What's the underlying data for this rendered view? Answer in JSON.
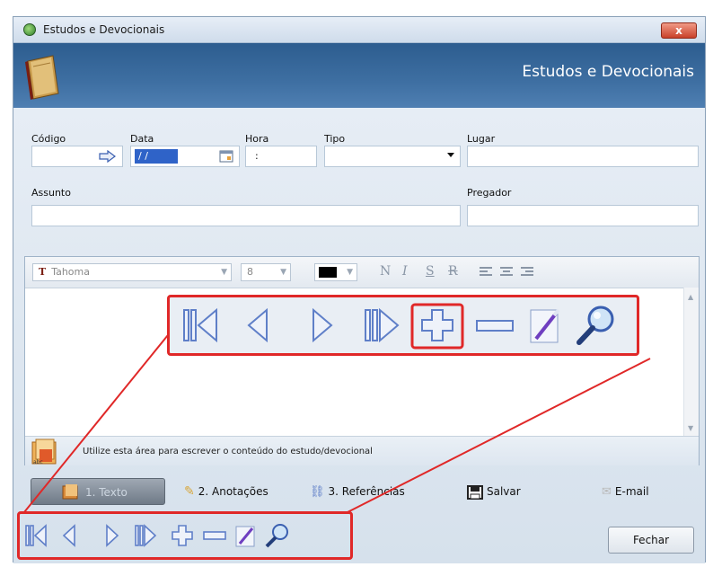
{
  "window": {
    "title": "Estudos e Devocionais",
    "close_label": "x"
  },
  "banner": {
    "title": "Estudos e Devocionais"
  },
  "form": {
    "codigo_label": "Código",
    "data_label": "Data",
    "data_value": "/ /",
    "hora_label": "Hora",
    "hora_value": ":",
    "tipo_label": "Tipo",
    "lugar_label": "Lugar",
    "assunto_label": "Assunto",
    "pregador_label": "Pregador"
  },
  "editor": {
    "font_name": "Tahoma",
    "font_size": "8",
    "bold": "N",
    "italic": "I",
    "underline": "S",
    "strike": "R",
    "hint": "Utilize esta área para escrever o conteúdo do estudo/devocional"
  },
  "tabs": [
    {
      "label": "1. Texto"
    },
    {
      "label": "2. Anotações"
    },
    {
      "label": "3. Referências"
    },
    {
      "label": "Salvar"
    },
    {
      "label": "E-mail"
    }
  ],
  "buttons": {
    "fechar": "Fechar"
  },
  "colors": {
    "accent_blue": "#3e6fa2",
    "highlight_red": "#e02828",
    "nav_icon_blue": "#5f7fc8"
  }
}
